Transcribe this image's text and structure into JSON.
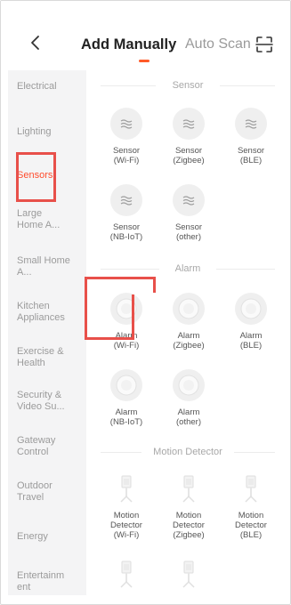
{
  "header": {
    "active_tab": "Add Manually",
    "inactive_tab": "Auto Scan"
  },
  "sidebar": {
    "items": [
      {
        "label": "Electrical"
      },
      {
        "label": "Lighting"
      },
      {
        "label": "Sensors",
        "active": true
      },
      {
        "label": "Large Home A..."
      },
      {
        "label": "Small Home A..."
      },
      {
        "label": "Kitchen Appliances"
      },
      {
        "label": "Exercise & Health"
      },
      {
        "label": "Security & Video Su..."
      },
      {
        "label": "Gateway Control"
      },
      {
        "label": "Outdoor Travel"
      },
      {
        "label": "Energy"
      },
      {
        "label": "Entertainment"
      }
    ]
  },
  "sections": {
    "sensor": {
      "title": "Sensor",
      "items": [
        {
          "label": "Sensor\n(Wi-Fi)",
          "icon": "sensor-wave-icon"
        },
        {
          "label": "Sensor\n(Zigbee)",
          "icon": "sensor-wave-icon"
        },
        {
          "label": "Sensor\n(BLE)",
          "icon": "sensor-wave-icon"
        },
        {
          "label": "Sensor\n(NB-IoT)",
          "icon": "sensor-wave-icon"
        },
        {
          "label": "Sensor\n(other)",
          "icon": "sensor-wave-icon"
        }
      ]
    },
    "alarm": {
      "title": "Alarm",
      "items": [
        {
          "label": "Alarm\n(Wi-Fi)",
          "icon": "alarm-disc-icon"
        },
        {
          "label": "Alarm\n(Zigbee)",
          "icon": "alarm-disc-icon"
        },
        {
          "label": "Alarm\n(BLE)",
          "icon": "alarm-disc-icon"
        },
        {
          "label": "Alarm\n(NB-IoT)",
          "icon": "alarm-disc-icon"
        },
        {
          "label": "Alarm\n(other)",
          "icon": "alarm-disc-icon"
        }
      ]
    },
    "motion": {
      "title": "Motion Detector",
      "items": [
        {
          "label": "Motion\nDetector\n(Wi-Fi)",
          "icon": "motion-detector-icon"
        },
        {
          "label": "Motion\nDetector\n(Zigbee)",
          "icon": "motion-detector-icon"
        },
        {
          "label": "Motion\nDetector\n(BLE)",
          "icon": "motion-detector-icon"
        },
        {
          "label": "",
          "icon": "motion-detector-icon"
        },
        {
          "label": "",
          "icon": "motion-detector-icon"
        }
      ]
    }
  },
  "colors": {
    "accent": "#ff5a28",
    "highlight_box": "#e8504a",
    "sidebar_bg": "#f4f4f5"
  }
}
